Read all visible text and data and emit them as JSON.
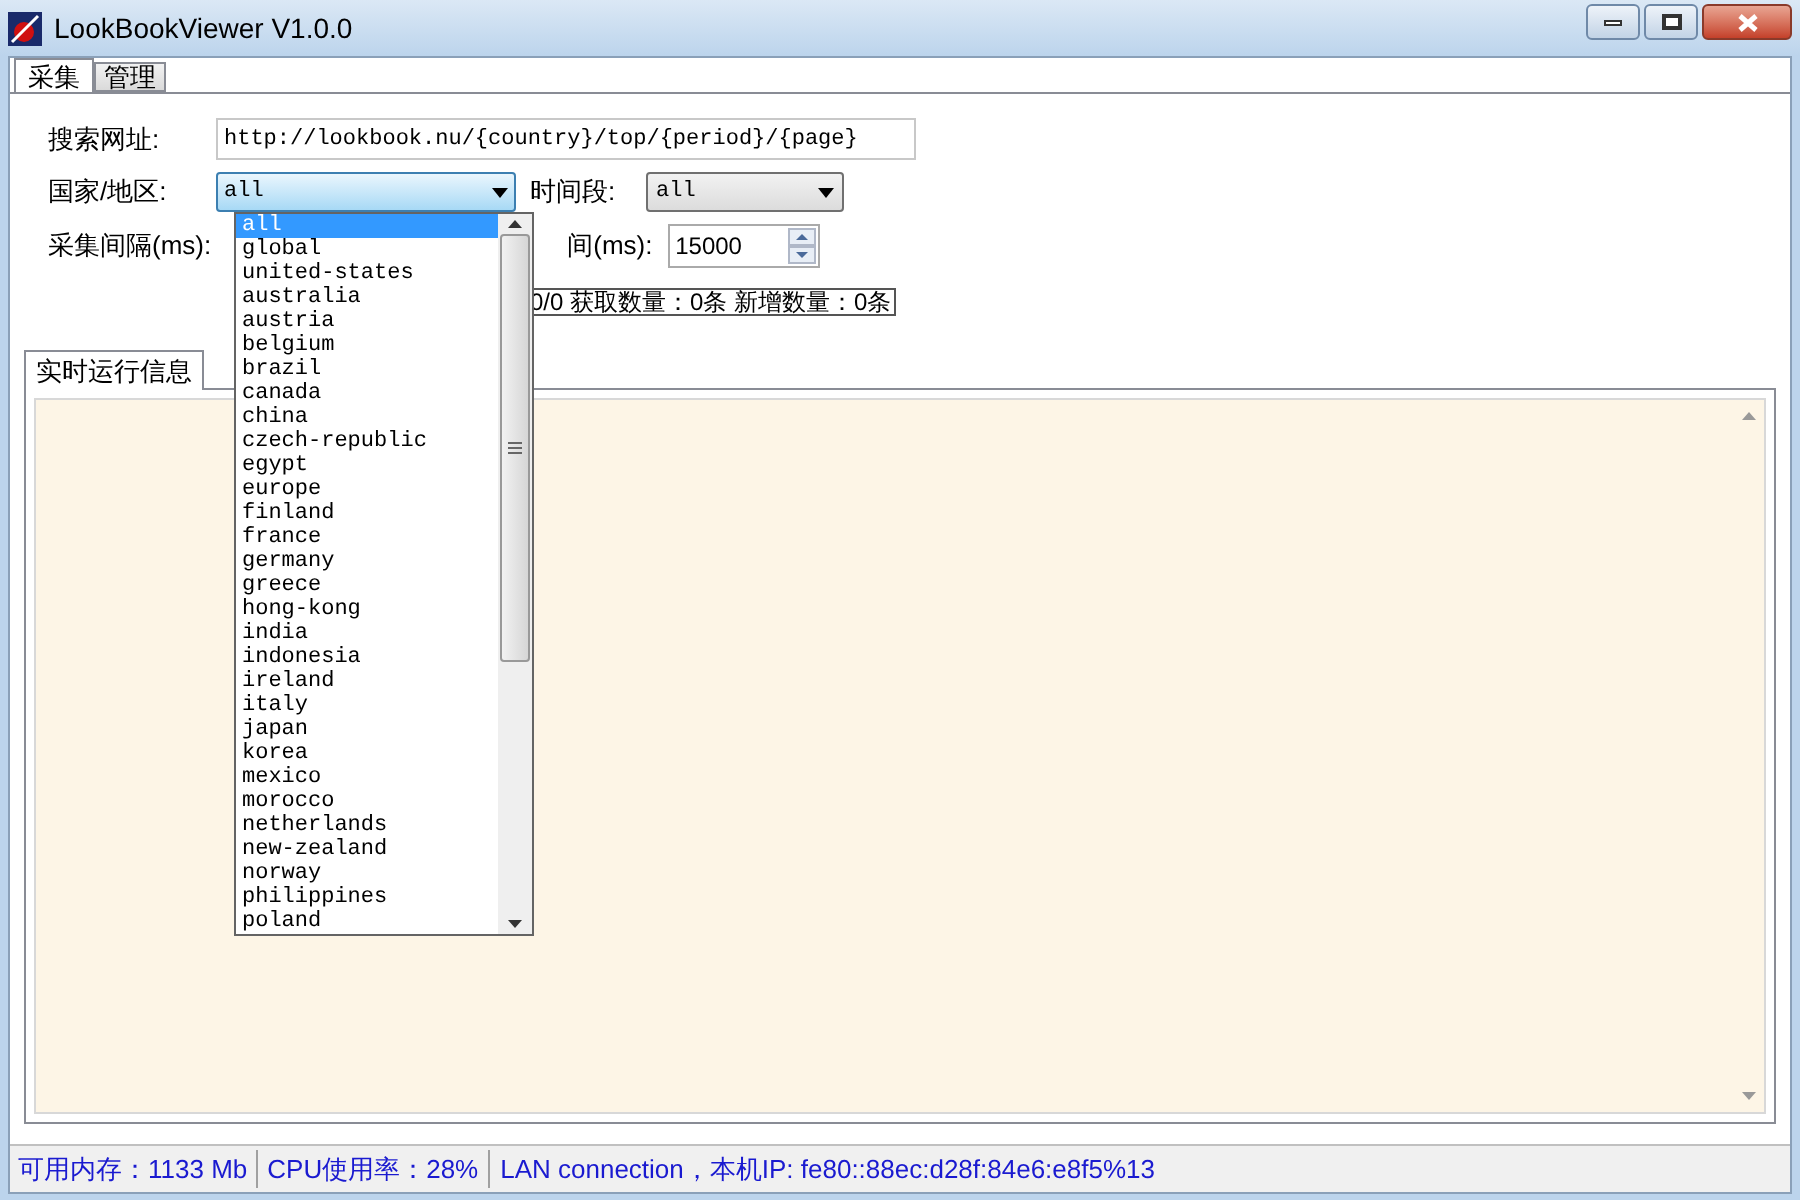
{
  "window": {
    "title": "LookBookViewer V1.0.0"
  },
  "tabs": [
    {
      "label": "采集",
      "selected": true
    },
    {
      "label": "管理",
      "selected": false
    }
  ],
  "form": {
    "url": {
      "label": "搜索网址:",
      "value": "http://lookbook.nu/{country}/top/{period}/{page}"
    },
    "country": {
      "label": "国家/地区:",
      "value": "all",
      "expanded": true,
      "options": [
        {
          "label": "all",
          "selected": true
        },
        {
          "label": "global",
          "selected": false
        },
        {
          "label": "united-states",
          "selected": false
        },
        {
          "label": "australia",
          "selected": false
        },
        {
          "label": "austria",
          "selected": false
        },
        {
          "label": "belgium",
          "selected": false
        },
        {
          "label": "brazil",
          "selected": false
        },
        {
          "label": "canada",
          "selected": false
        },
        {
          "label": "china",
          "selected": false
        },
        {
          "label": "czech-republic",
          "selected": false
        },
        {
          "label": "egypt",
          "selected": false
        },
        {
          "label": "europe",
          "selected": false
        },
        {
          "label": "finland",
          "selected": false
        },
        {
          "label": "france",
          "selected": false
        },
        {
          "label": "germany",
          "selected": false
        },
        {
          "label": "greece",
          "selected": false
        },
        {
          "label": "hong-kong",
          "selected": false
        },
        {
          "label": "india",
          "selected": false
        },
        {
          "label": "indonesia",
          "selected": false
        },
        {
          "label": "ireland",
          "selected": false
        },
        {
          "label": "italy",
          "selected": false
        },
        {
          "label": "japan",
          "selected": false
        },
        {
          "label": "korea",
          "selected": false
        },
        {
          "label": "mexico",
          "selected": false
        },
        {
          "label": "morocco",
          "selected": false
        },
        {
          "label": "netherlands",
          "selected": false
        },
        {
          "label": "new-zealand",
          "selected": false
        },
        {
          "label": "norway",
          "selected": false
        },
        {
          "label": "philippines",
          "selected": false
        },
        {
          "label": "poland",
          "selected": false
        }
      ]
    },
    "period": {
      "label": "时间段:",
      "value": "all"
    },
    "interval": {
      "label": "采集间隔(ms):"
    },
    "second_interval": {
      "label": "间(ms):",
      "value": "15000"
    },
    "progress": "0/0 获取数量：0条 新增数量：0条"
  },
  "log_tabs": [
    {
      "label": "实时运行信息",
      "selected": true
    }
  ],
  "status_bar": [
    "可用内存：1133 Mb",
    "CPU使用率：28%",
    "LAN connection，本机IP: fe80::88ec:d28f:84e6:e8f5%13"
  ]
}
